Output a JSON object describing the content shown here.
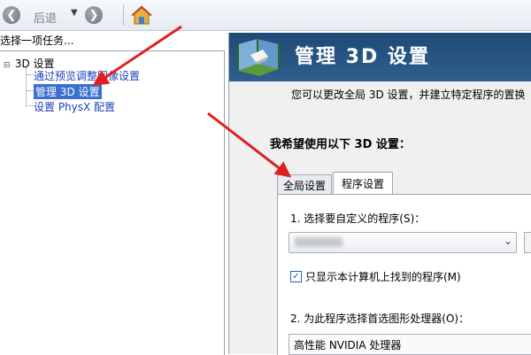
{
  "toolbar": {
    "back_label": "后退",
    "icons": [
      "back-arrow-icon",
      "chevron-down-icon",
      "forward-arrow-icon",
      "home-icon"
    ]
  },
  "left_pane": {
    "header": "选择一项任务...",
    "tree": {
      "root_label": "3D 设置",
      "toggle": "⊟",
      "items": [
        {
          "label": "通过预览调整图像设置",
          "selected": false
        },
        {
          "label": "管理 3D 设置",
          "selected": true
        },
        {
          "label": "设置 PhysX 配置",
          "selected": false
        }
      ]
    }
  },
  "right_pane": {
    "banner_title": "管理 3D 设置",
    "description": "您可以更改全局 3D 设置，并建立特定程序的置换",
    "section_label": "我希望使用以下 3D 设置：",
    "tabs": [
      {
        "label": "全局设置",
        "active": false
      },
      {
        "label": "程序设置",
        "active": true
      }
    ],
    "program_settings": {
      "select_label": "1. 选择要自定义的程序(S)：",
      "select_value": "",
      "checkbox_label": "只显示本计算机上找到的程序(M)",
      "checkbox_checked": true,
      "checkbox_mark": "✓",
      "gpu_label": "2. 为此程序选择首选图形处理器(O)：",
      "gpu_value": "高性能 NVIDIA 处理器"
    }
  },
  "colors": {
    "annotation_arrow": "#e02020",
    "banner_bg": "#24507f",
    "selection_bg": "#3a6fd0",
    "link_text": "#1d3fbf"
  }
}
